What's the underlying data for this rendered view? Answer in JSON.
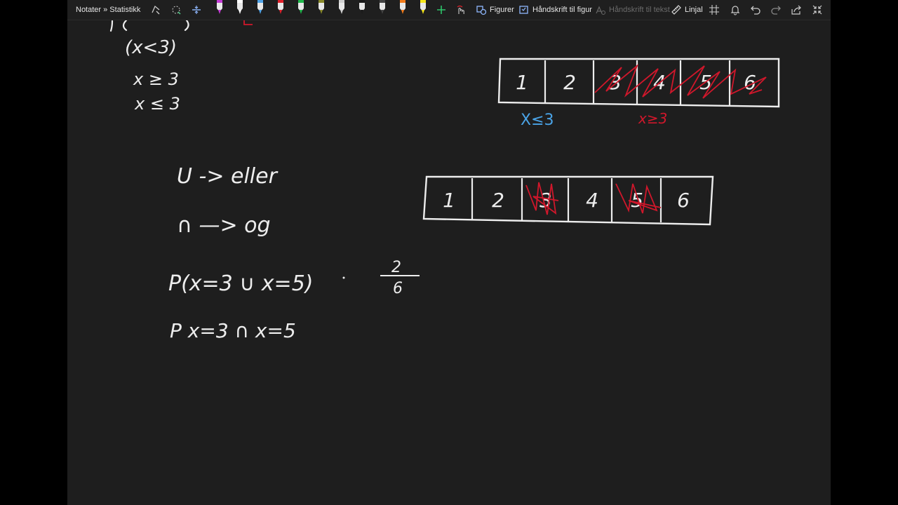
{
  "toolbar": {
    "breadcrumb": "Notater » Statistikk",
    "shapes_label": "Figurer",
    "ink_to_shape_label": "Håndskrift til figur",
    "ink_to_text_label": "Håndskrift til tekst",
    "ruler_label": "Linjal"
  },
  "pens": [
    {
      "name": "pen-purple",
      "color": "#c43ad6"
    },
    {
      "name": "pen-white",
      "color": "#ffffff"
    },
    {
      "name": "pen-blue",
      "color": "#4fa3e8"
    },
    {
      "name": "pen-red",
      "color": "#e0202a"
    },
    {
      "name": "pen-green",
      "color": "#1fb84a"
    },
    {
      "name": "pen-olive",
      "color": "#8a8a2a"
    },
    {
      "name": "pen-gray",
      "color": "#cfcfcf"
    },
    {
      "name": "pen-black",
      "color": "#1a1a1a"
    },
    {
      "name": "pen-dark",
      "color": "#444444"
    },
    {
      "name": "highlighter-orange",
      "color": "#f07a1a"
    },
    {
      "name": "highlighter-yellow",
      "color": "#f5e61a"
    }
  ],
  "notes": {
    "line_a": "(x<3)",
    "line_b": "x ≥ 3",
    "line_c": "x ≤ 3",
    "union": "U -> eller",
    "intersection": "∩ —> og",
    "prob_union": "P(x=3 ∪ x=5)",
    "frac_num": "2",
    "frac_den": "6",
    "prob_inter": "P x=3 ∩ x=5",
    "label_le": "X≤3",
    "label_ge": "x≥3"
  },
  "box_top": [
    "1",
    "2",
    "3",
    "4",
    "5",
    "6"
  ],
  "box_bottom": [
    "1",
    "2",
    "3",
    "4",
    "5",
    "6"
  ],
  "colors": {
    "ink_white": "#ededed",
    "ink_red": "#d0172b",
    "ink_blue": "#4aa3e6",
    "canvas": "#1e1e1e"
  }
}
